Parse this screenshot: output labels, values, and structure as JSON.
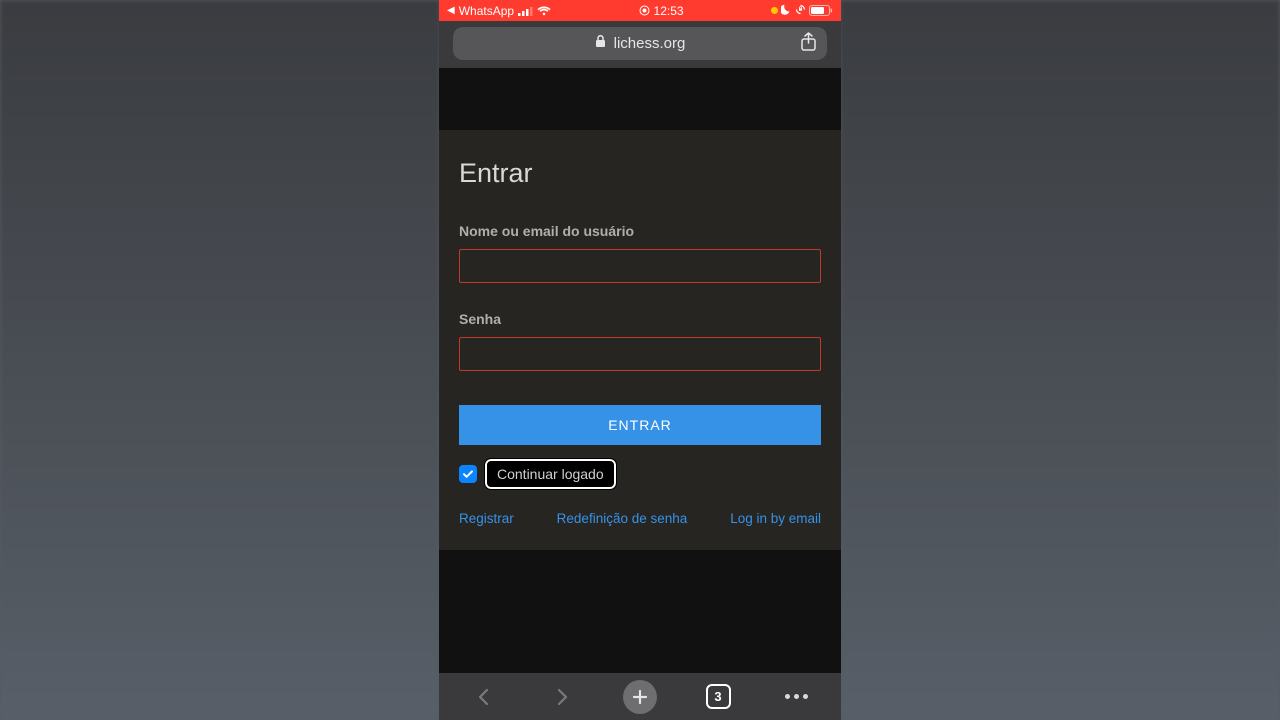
{
  "statusbar": {
    "back_app": "WhatsApp",
    "time": "12:53"
  },
  "urlbar": {
    "domain": "lichess.org"
  },
  "page": {
    "title": "Entrar",
    "username_label": "Nome ou email do usuário",
    "password_label": "Senha",
    "submit_label": "ENTRAR",
    "remember_label": "Continuar logado",
    "links": {
      "register": "Registrar",
      "reset": "Redefinição de senha",
      "email_login": "Log in by email"
    }
  },
  "toolbar": {
    "tab_count": "3"
  }
}
